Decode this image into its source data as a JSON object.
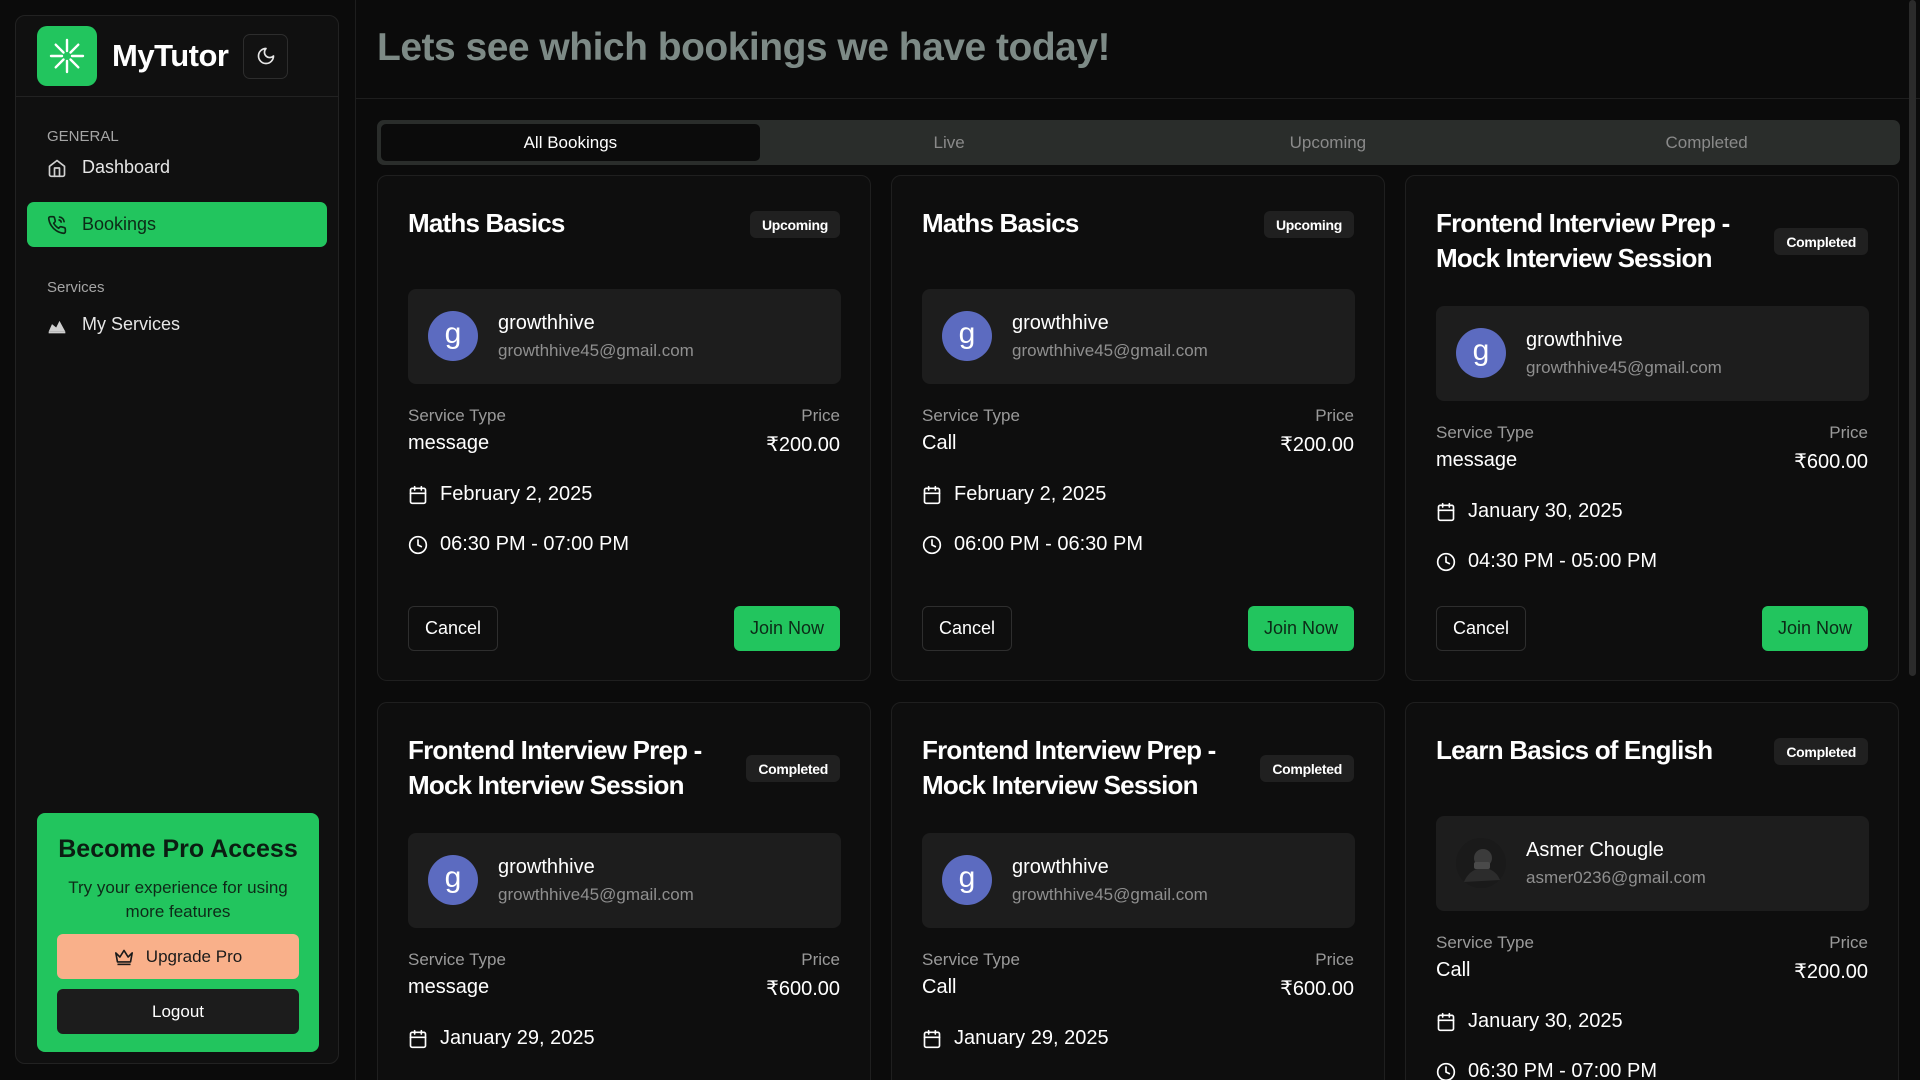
{
  "app": {
    "name": "MyTutor"
  },
  "header": {
    "title": "Lets see which bookings we have today!"
  },
  "sidebar": {
    "groups": [
      {
        "label": "GENERAL",
        "items": [
          {
            "label": "Dashboard",
            "icon": "home-icon"
          },
          {
            "label": "Bookings",
            "icon": "phone-icon",
            "active": true
          }
        ]
      },
      {
        "label": "Services",
        "items": [
          {
            "label": "My Services",
            "icon": "services-icon"
          }
        ]
      }
    ],
    "pro": {
      "title": "Become Pro Access",
      "subtitle": "Try your experience for using more features",
      "upgrade_label": "Upgrade Pro",
      "logout_label": "Logout"
    }
  },
  "tabs": [
    {
      "label": "All Bookings",
      "active": true
    },
    {
      "label": "Live"
    },
    {
      "label": "Upcoming"
    },
    {
      "label": "Completed"
    }
  ],
  "labels": {
    "service_type": "Service Type",
    "price": "Price",
    "cancel": "Cancel",
    "join": "Join Now"
  },
  "bookings": [
    {
      "title": "Maths Basics",
      "status": "Upcoming",
      "user": {
        "initial": "g",
        "name": "growthhive",
        "email": "growthhive45@gmail.com"
      },
      "service_type": "message",
      "price": "₹200.00",
      "date": "February 2, 2025",
      "time": "06:30 PM - 07:00 PM"
    },
    {
      "title": "Maths Basics",
      "status": "Upcoming",
      "user": {
        "initial": "g",
        "name": "growthhive",
        "email": "growthhive45@gmail.com"
      },
      "service_type": "Call",
      "price": "₹200.00",
      "date": "February 2, 2025",
      "time": "06:00 PM - 06:30 PM"
    },
    {
      "title": "Frontend Interview Prep - Mock Interview Session",
      "status": "Completed",
      "user": {
        "initial": "g",
        "name": "growthhive",
        "email": "growthhive45@gmail.com"
      },
      "service_type": "message",
      "price": "₹600.00",
      "date": "January 30, 2025",
      "time": "04:30 PM - 05:00 PM"
    },
    {
      "title": "Frontend Interview Prep - Mock Interview Session",
      "status": "Completed",
      "user": {
        "initial": "g",
        "name": "growthhive",
        "email": "growthhive45@gmail.com"
      },
      "service_type": "message",
      "price": "₹600.00",
      "date": "January 29, 2025"
    },
    {
      "title": "Frontend Interview Prep - Mock Interview Session",
      "status": "Completed",
      "user": {
        "initial": "g",
        "name": "growthhive",
        "email": "growthhive45@gmail.com"
      },
      "service_type": "Call",
      "price": "₹600.00",
      "date": "January 29, 2025"
    },
    {
      "title": "Learn Basics of English",
      "status": "Completed",
      "user": {
        "name": "Asmer Chougle",
        "email": "asmer0236@gmail.com",
        "avatar": "photo"
      },
      "service_type": "Call",
      "price": "₹200.00",
      "date": "January 30, 2025",
      "time": "06:30 PM - 07:00 PM"
    }
  ],
  "colors": {
    "accent": "#22c55e",
    "upgrade": "#f9b08a",
    "avatar": "#5c6bc0",
    "title": "#7d8a86"
  }
}
